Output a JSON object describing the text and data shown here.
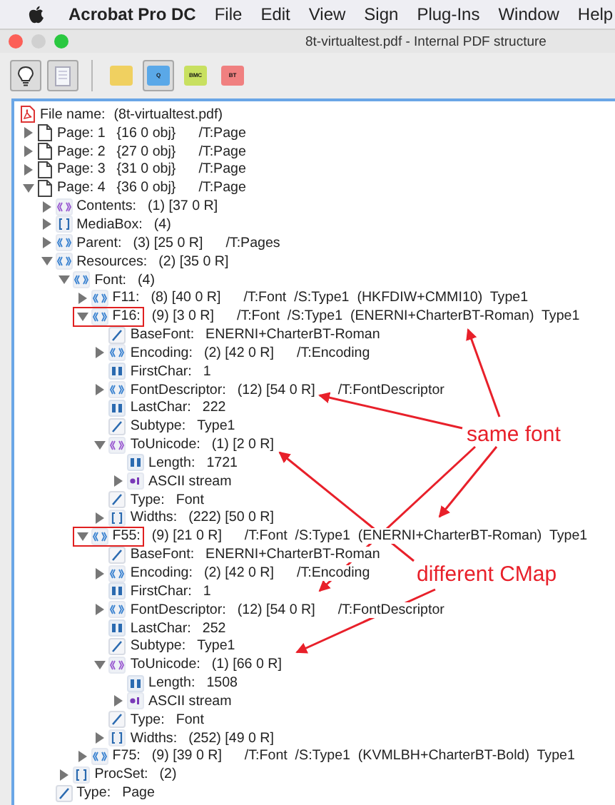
{
  "menu_bar": {
    "app_name": "Acrobat Pro DC",
    "items": [
      "File",
      "Edit",
      "View",
      "Sign",
      "Plug-Ins",
      "Window",
      "Help"
    ]
  },
  "window": {
    "title": "8t-virtualtest.pdf - Internal PDF structure"
  },
  "toolbar": [
    {
      "kind": "bulb",
      "selected": true
    },
    {
      "kind": "page",
      "selected": true
    },
    {
      "kind": "divider"
    },
    {
      "kind": "puzzle",
      "color": "#f0d060",
      "selected": false
    },
    {
      "kind": "puzzle",
      "color": "#5aa8e8",
      "label": "Q",
      "selected": true
    },
    {
      "kind": "puzzle",
      "color": "#c8e060",
      "label": "BMC",
      "selected": false
    },
    {
      "kind": "puzzle",
      "color": "#f08080",
      "label": "BT",
      "selected": false
    }
  ],
  "tree": {
    "kind": "pdf",
    "label": "File name:",
    "value": "(8t-virtualtest.pdf)",
    "children": [
      {
        "kind": "page",
        "label": "Page: 1",
        "value": "{16 0 obj}",
        "extra": "/T:Page",
        "expanded": false
      },
      {
        "kind": "page",
        "label": "Page: 2",
        "value": "{27 0 obj}",
        "extra": "/T:Page",
        "expanded": false
      },
      {
        "kind": "page",
        "label": "Page: 3",
        "value": "{31 0 obj}",
        "extra": "/T:Page",
        "expanded": false
      },
      {
        "kind": "page",
        "label": "Page: 4",
        "value": "{36 0 obj}",
        "extra": "/T:Page",
        "expanded": true,
        "children": [
          {
            "kind": "stream_dict",
            "label": "Contents:",
            "value": "(1) [37 0 R]",
            "expanded": false
          },
          {
            "kind": "array",
            "label": "MediaBox:",
            "value": "(4)",
            "expanded": false
          },
          {
            "kind": "dict",
            "label": "Parent:",
            "value": "(3) [25 0 R]",
            "extra": "/T:Pages",
            "expanded": false
          },
          {
            "kind": "dict",
            "label": "Resources:",
            "value": "(2) [35 0 R]",
            "expanded": true,
            "children": [
              {
                "kind": "dict",
                "label": "Font:",
                "value": "(4)",
                "expanded": true,
                "children": [
                  {
                    "kind": "dict",
                    "label": "F11:",
                    "value": "(8) [40 0 R]",
                    "extra": "/T:Font  /S:Type1  (HKFDIW+CMMI10)  Type1",
                    "expanded": false
                  },
                  {
                    "kind": "dict",
                    "label": "F16:",
                    "value": "(9) [3 0 R]",
                    "extra": "/T:Font  /S:Type1  (ENERNI+CharterBT-Roman)  Type1",
                    "expanded": true,
                    "marked": true,
                    "children": [
                      {
                        "kind": "name",
                        "label": "BaseFont:",
                        "value": "ENERNI+CharterBT-Roman"
                      },
                      {
                        "kind": "dict",
                        "label": "Encoding:",
                        "value": "(2) [42 0 R]",
                        "extra": "/T:Encoding",
                        "expanded": false
                      },
                      {
                        "kind": "number",
                        "label": "FirstChar:",
                        "value": "1"
                      },
                      {
                        "kind": "dict",
                        "label": "FontDescriptor:",
                        "value": "(12) [54 0 R]",
                        "extra": "/T:FontDescriptor",
                        "expanded": false
                      },
                      {
                        "kind": "number",
                        "label": "LastChar:",
                        "value": "222"
                      },
                      {
                        "kind": "name",
                        "label": "Subtype:",
                        "value": "Type1"
                      },
                      {
                        "kind": "stream_dict",
                        "label": "ToUnicode:",
                        "value": "(1) [2 0 R]",
                        "expanded": true,
                        "children": [
                          {
                            "kind": "number",
                            "label": "Length:",
                            "value": "1721"
                          },
                          {
                            "kind": "stream",
                            "label": "ASCII stream",
                            "expanded": false
                          }
                        ]
                      },
                      {
                        "kind": "name",
                        "label": "Type:",
                        "value": "Font"
                      },
                      {
                        "kind": "array",
                        "label": "Widths:",
                        "value": "(222) [50 0 R]",
                        "expanded": false
                      }
                    ]
                  },
                  {
                    "kind": "dict",
                    "label": "F55:",
                    "value": "(9) [21 0 R]",
                    "extra": "/T:Font  /S:Type1  (ENERNI+CharterBT-Roman)  Type1",
                    "expanded": true,
                    "marked": true,
                    "children": [
                      {
                        "kind": "name",
                        "label": "BaseFont:",
                        "value": "ENERNI+CharterBT-Roman"
                      },
                      {
                        "kind": "dict",
                        "label": "Encoding:",
                        "value": "(2) [42 0 R]",
                        "extra": "/T:Encoding",
                        "expanded": false
                      },
                      {
                        "kind": "number",
                        "label": "FirstChar:",
                        "value": "1"
                      },
                      {
                        "kind": "dict",
                        "label": "FontDescriptor:",
                        "value": "(12) [54 0 R]",
                        "extra": "/T:FontDescriptor",
                        "expanded": false
                      },
                      {
                        "kind": "number",
                        "label": "LastChar:",
                        "value": "252"
                      },
                      {
                        "kind": "name",
                        "label": "Subtype:",
                        "value": "Type1"
                      },
                      {
                        "kind": "stream_dict",
                        "label": "ToUnicode:",
                        "value": "(1) [66 0 R]",
                        "expanded": true,
                        "children": [
                          {
                            "kind": "number",
                            "label": "Length:",
                            "value": "1508"
                          },
                          {
                            "kind": "stream",
                            "label": "ASCII stream",
                            "expanded": false
                          }
                        ]
                      },
                      {
                        "kind": "name",
                        "label": "Type:",
                        "value": "Font"
                      },
                      {
                        "kind": "array",
                        "label": "Widths:",
                        "value": "(252) [49 0 R]",
                        "expanded": false
                      }
                    ]
                  },
                  {
                    "kind": "dict",
                    "label": "F75:",
                    "value": "(9) [39 0 R]",
                    "extra": "/T:Font  /S:Type1  (KVMLBH+CharterBT-Bold)  Type1",
                    "expanded": false
                  }
                ]
              },
              {
                "kind": "array",
                "label": "ProcSet:",
                "value": "(2)",
                "expanded": false
              }
            ]
          },
          {
            "kind": "name",
            "label": "Type:",
            "value": "Page"
          }
        ]
      }
    ]
  },
  "annotations": [
    {
      "kind": "same_font",
      "text": "same font"
    },
    {
      "kind": "different_cmap",
      "text": "different CMap"
    }
  ]
}
